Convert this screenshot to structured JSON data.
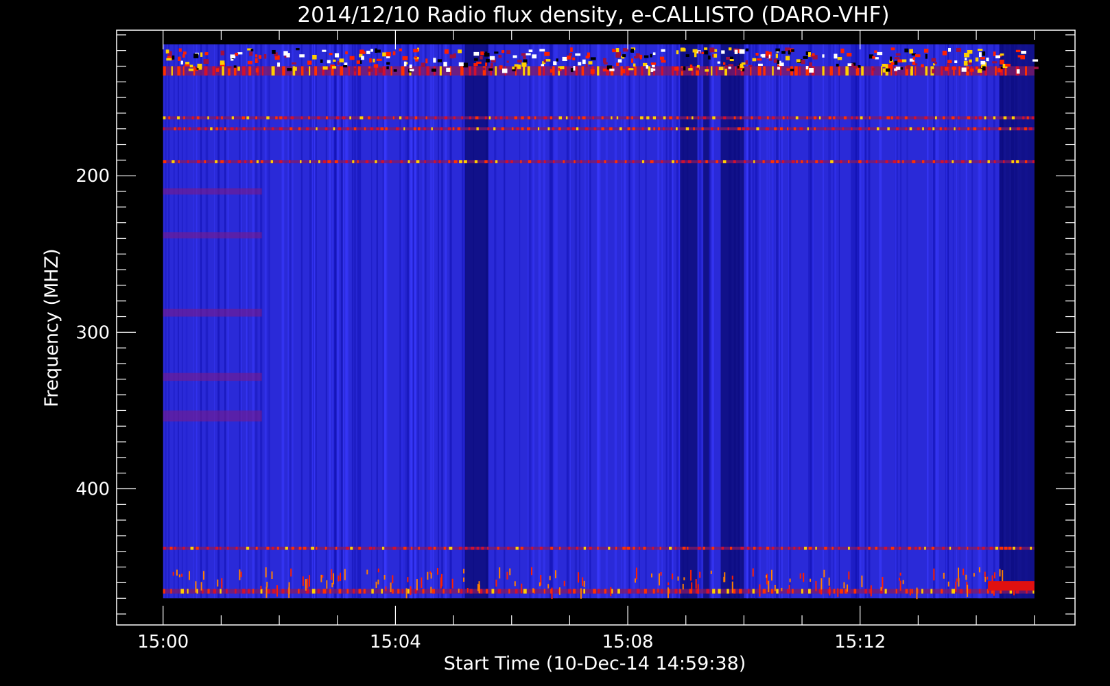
{
  "chart_data": {
    "type": "heatmap",
    "title": "2014/12/10  Radio flux density, e-CALLISTO (DARO-VHF)",
    "xlabel": "Start Time (10-Dec-14 14:59:38)",
    "ylabel": "Frequency (MHZ)",
    "x_ticks": [
      "15:00",
      "15:04",
      "15:08",
      "15:12"
    ],
    "y_ticks": [
      "200",
      "300",
      "400"
    ],
    "x_range_minutes": [
      -0.8,
      15.7
    ],
    "data_x_range_minutes": [
      0,
      15
    ],
    "y_range_mhz": [
      107,
      487
    ],
    "data_y_range_mhz": [
      116,
      470
    ],
    "colormap": [
      "#000000",
      "#0000ff",
      "#7a1a8a",
      "#ff2000",
      "#ffd000",
      "#ffffff"
    ],
    "background_color": "#2a2ad8",
    "dark_time_bands_minutes": [
      [
        5.2,
        5.6
      ],
      [
        8.9,
        9.2
      ],
      [
        9.3,
        9.4
      ],
      [
        9.6,
        10.0
      ],
      [
        14.4,
        15.0
      ]
    ],
    "bright_frequency_bands_mhz": [
      [
        130,
        136
      ],
      [
        162,
        164
      ],
      [
        169,
        171
      ],
      [
        190,
        192
      ],
      [
        437,
        439
      ],
      [
        464,
        467
      ]
    ]
  }
}
